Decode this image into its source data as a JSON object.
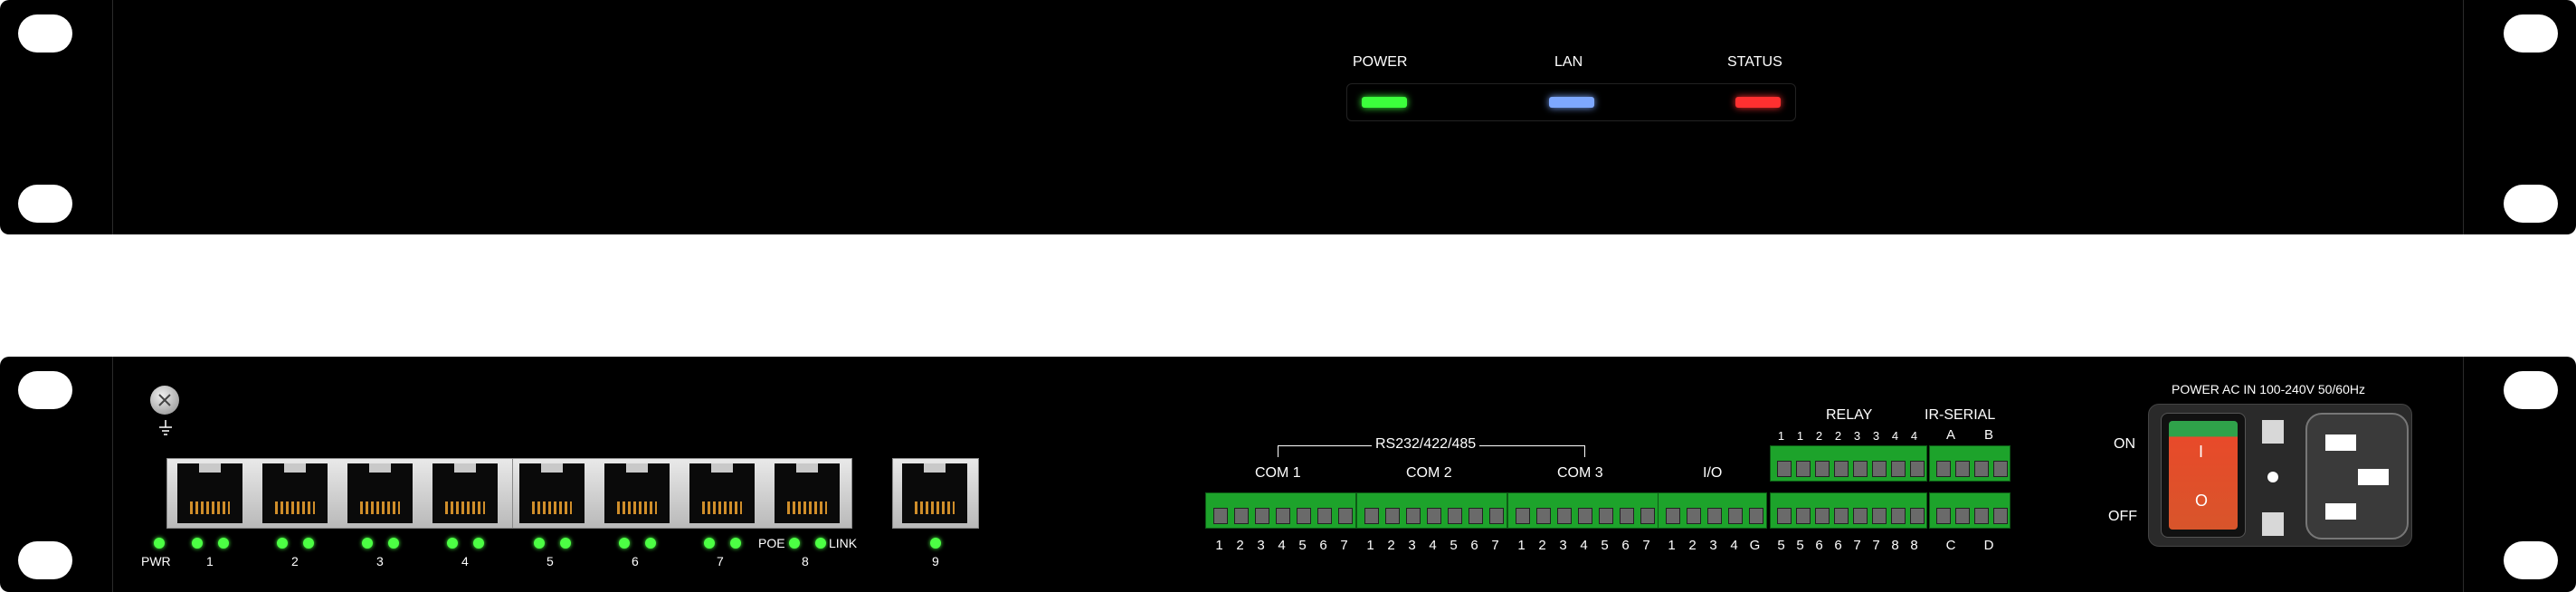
{
  "front": {
    "indicators": [
      {
        "label": "POWER",
        "color": "#3cff3c"
      },
      {
        "label": "LAN",
        "color": "#7ea8ff"
      },
      {
        "label": "STATUS",
        "color": "#ff3030"
      }
    ]
  },
  "rear": {
    "ethernet": {
      "pwr_label": "PWR",
      "port_labels": [
        "1",
        "2",
        "3",
        "4",
        "5",
        "6",
        "7",
        "8"
      ],
      "poe_label": "POE",
      "link_label": "LINK",
      "uplink_label": "9"
    },
    "serial": {
      "group_label": "RS232/422/485",
      "ports": [
        {
          "label": "COM 1",
          "pins": [
            "1",
            "2",
            "3",
            "4",
            "5",
            "6",
            "7"
          ]
        },
        {
          "label": "COM 2",
          "pins": [
            "1",
            "2",
            "3",
            "4",
            "5",
            "6",
            "7"
          ]
        },
        {
          "label": "COM 3",
          "pins": [
            "1",
            "2",
            "3",
            "4",
            "5",
            "6",
            "7"
          ]
        }
      ]
    },
    "io": {
      "label": "I/O",
      "pins": [
        "1",
        "2",
        "3",
        "4",
        "G"
      ]
    },
    "relay": {
      "label": "RELAY",
      "top_pins": [
        "1",
        "1",
        "2",
        "2",
        "3",
        "3",
        "4",
        "4"
      ],
      "bottom_pins": [
        "5",
        "5",
        "6",
        "6",
        "7",
        "7",
        "8",
        "8"
      ]
    },
    "ir_serial": {
      "label": "IR-SERIAL",
      "top_pins": [
        "A",
        "B"
      ],
      "bottom_pins": [
        "C",
        "D"
      ]
    },
    "power": {
      "title": "POWER AC IN  100-240V 50/60Hz",
      "on_label": "ON",
      "off_label": "OFF",
      "switch_on_mark": "I",
      "switch_off_mark": "O"
    }
  }
}
